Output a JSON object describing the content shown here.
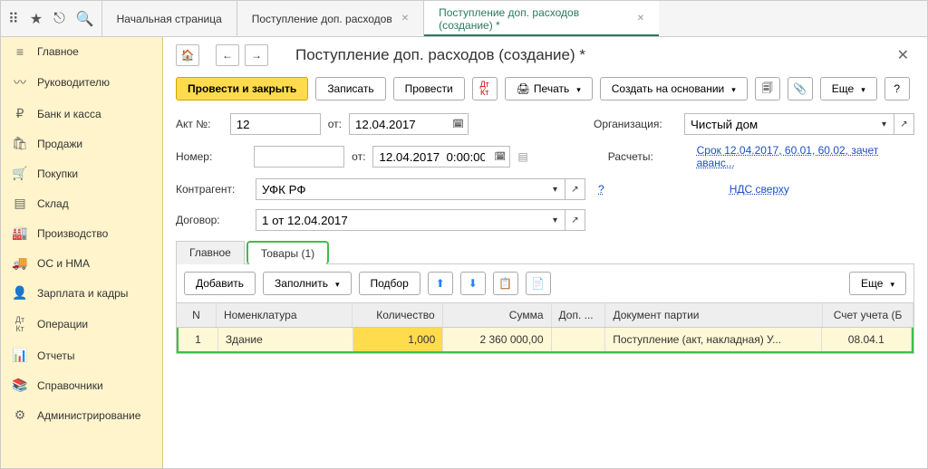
{
  "topbar": {
    "icons": [
      "apps-icon",
      "star-icon",
      "pin-icon",
      "search-icon"
    ]
  },
  "tabs": [
    {
      "label": "Начальная страница",
      "closable": false
    },
    {
      "label": "Поступление доп. расходов",
      "closable": true
    },
    {
      "label": "Поступление доп. расходов (создание) *",
      "closable": true,
      "active": true
    }
  ],
  "sidebar": [
    {
      "icon": "≡",
      "label": "Главное"
    },
    {
      "icon": "✓",
      "label": "Руководителю"
    },
    {
      "icon": "₽",
      "label": "Банк и касса"
    },
    {
      "icon": "🛍",
      "label": "Продажи"
    },
    {
      "icon": "🛒",
      "label": "Покупки"
    },
    {
      "icon": "▤",
      "label": "Склад"
    },
    {
      "icon": "🏭",
      "label": "Производство"
    },
    {
      "icon": "🚚",
      "label": "ОС и НМА"
    },
    {
      "icon": "👤",
      "label": "Зарплата и кадры"
    },
    {
      "icon": "Дт",
      "label": "Операции"
    },
    {
      "icon": "📊",
      "label": "Отчеты"
    },
    {
      "icon": "📚",
      "label": "Справочники"
    },
    {
      "icon": "⚙",
      "label": "Администрирование"
    }
  ],
  "page": {
    "title": "Поступление доп. расходов (создание) *"
  },
  "toolbar": {
    "post_close": "Провести и закрыть",
    "save": "Записать",
    "post": "Провести",
    "print": "Печать",
    "create_based": "Создать на основании",
    "more": "Еще",
    "help": "?"
  },
  "form": {
    "akt_label": "Акт №:",
    "akt_value": "12",
    "ot_label": "от:",
    "akt_date": "12.04.2017",
    "nomer_label": "Номер:",
    "nomer_value": "",
    "nomer_date": "12.04.2017  0:00:00",
    "org_label": "Организация:",
    "org_value": "Чистый дом",
    "rasch_label": "Расчеты:",
    "rasch_link": "Срок 12.04.2017, 60.01, 60.02, зачет аванс...",
    "kontr_label": "Контрагент:",
    "kontr_value": "УФК РФ",
    "nds_link": "НДС сверху",
    "dogovor_label": "Договор:",
    "dogovor_value": "1 от 12.04.2017"
  },
  "subtabs": {
    "main": "Главное",
    "goods": "Товары (1)"
  },
  "subtoolbar": {
    "add": "Добавить",
    "fill": "Заполнить",
    "select": "Подбор",
    "more": "Еще"
  },
  "grid": {
    "headers": {
      "n": "N",
      "nom": "Номенклатура",
      "qty": "Количество",
      "sum": "Сумма",
      "dop": "Доп. ...",
      "doc": "Документ партии",
      "acct": "Счет учета (Б"
    },
    "rows": [
      {
        "n": "1",
        "nom": "Здание",
        "qty": "1,000",
        "sum": "2 360 000,00",
        "dop": "",
        "doc": "Поступление (акт, накладная) У...",
        "acct": "08.04.1"
      }
    ]
  }
}
